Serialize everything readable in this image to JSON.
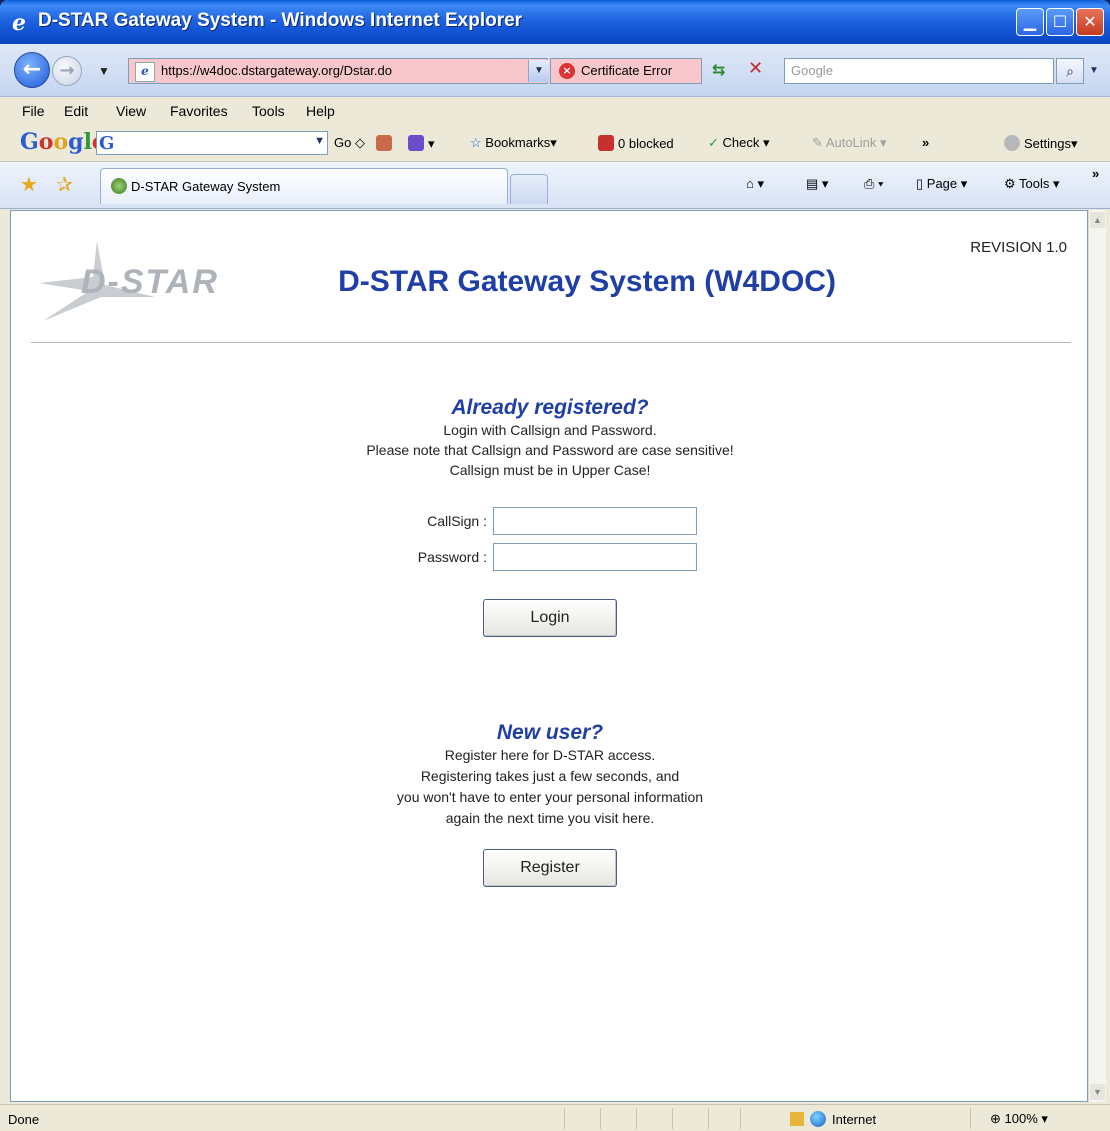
{
  "window": {
    "title": "D-STAR Gateway System - Windows Internet Explorer",
    "controls": {
      "minimize": "▁",
      "maximize": "☐",
      "close": "✕"
    }
  },
  "address_bar": {
    "url": "https://w4doc.dstargateway.org/Dstar.do",
    "certificate": "Certificate Error",
    "search_placeholder": "Google"
  },
  "menu": {
    "items": [
      "File",
      "Edit",
      "View",
      "Favorites",
      "Tools",
      "Help"
    ]
  },
  "google_toolbar": {
    "go_label": "Go",
    "bookmarks_label": "Bookmarks▾",
    "blocked_label": "0 blocked",
    "check_label": "Check ▾",
    "autolink_label": "AutoLink ▾",
    "more_label": "»",
    "settings_label": "Settings▾"
  },
  "tab": {
    "label": "D-STAR Gateway System"
  },
  "command_bar": {
    "page_label": "Page ▾",
    "tools_label": "Tools ▾"
  },
  "page": {
    "logo_text": "D-STAR",
    "revision": "REVISION 1.0",
    "title": "D-STAR Gateway System (W4DOC)",
    "login": {
      "heading": "Already registered?",
      "lines": [
        "Login with Callsign and Password.",
        "Please note that Callsign and Password are case sensitive!",
        "Callsign must be in Upper Case!"
      ],
      "callsign_label": "CallSign :",
      "password_label": "Password :",
      "callsign_value": "",
      "password_value": "",
      "button": "Login"
    },
    "register": {
      "heading": "New user?",
      "lines": [
        "Register here for D-STAR access.",
        "Registering takes just a few seconds, and",
        "you won't have to enter your personal information",
        "again the next time you visit here."
      ],
      "button": "Register"
    }
  },
  "status_bar": {
    "status": "Done",
    "zone": "Internet",
    "zoom": "100%"
  }
}
